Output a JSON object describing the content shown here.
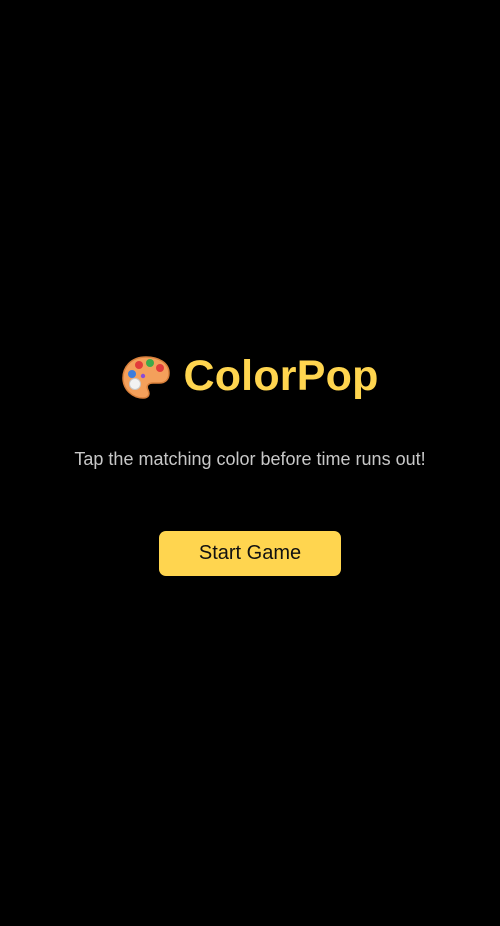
{
  "app": {
    "title": "ColorPop",
    "title_icon": "artist-palette-icon"
  },
  "intro": {
    "subtitle": "Tap the matching color before time runs out!",
    "start_label": "Start Game"
  },
  "colors": {
    "background": "#000000",
    "accent": "#FFD54F",
    "subtitle_text": "#C8C8C8",
    "button_text": "#111111"
  }
}
